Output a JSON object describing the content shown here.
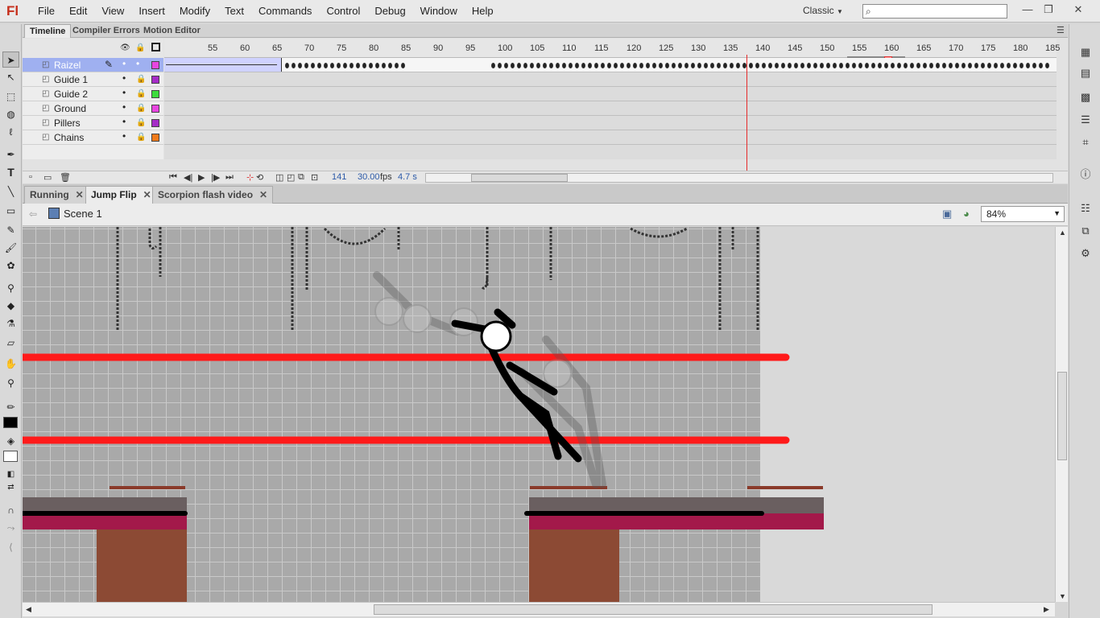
{
  "app": {
    "logo": "Fl"
  },
  "menu": [
    "File",
    "Edit",
    "View",
    "Insert",
    "Modify",
    "Text",
    "Commands",
    "Control",
    "Debug",
    "Window",
    "Help"
  ],
  "workspace": {
    "label": "Classic"
  },
  "search": {
    "placeholder": ""
  },
  "window_controls": {
    "minimize": "—",
    "restore": "❐",
    "close": "✕"
  },
  "timeline": {
    "tabs": [
      "Timeline",
      "Compiler Errors",
      "Motion Editor"
    ],
    "layers": [
      {
        "name": "Raizel",
        "color": "#e845e0",
        "selected": true
      },
      {
        "name": "Guide 1",
        "color": "#a52cc7",
        "selected": false
      },
      {
        "name": "Guide 2",
        "color": "#3cdc3c",
        "selected": false
      },
      {
        "name": "Ground",
        "color": "#e845e0",
        "selected": false
      },
      {
        "name": "Pillers",
        "color": "#a52cc7",
        "selected": false
      },
      {
        "name": "Chains",
        "color": "#f07a1a",
        "selected": false
      }
    ],
    "ruler_labels": [
      "55",
      "60",
      "65",
      "70",
      "75",
      "80",
      "85",
      "90",
      "95",
      "100",
      "105",
      "110",
      "115",
      "120",
      "125",
      "130",
      "135",
      "140",
      "145",
      "150",
      "155",
      "160",
      "165",
      "170",
      "175",
      "180",
      "185"
    ],
    "current_frame": "141",
    "fps": "30.00",
    "fps_unit": "fps",
    "elapsed": "4.7 s"
  },
  "doc_tabs": [
    {
      "label": "Running",
      "active": false
    },
    {
      "label": "Jump Flip",
      "active": true
    },
    {
      "label": "Scorpion flash video",
      "active": false
    }
  ],
  "editbar": {
    "scene": "Scene 1",
    "zoom": "84%"
  },
  "icons": {
    "tools": [
      "selection-icon",
      "subselection-icon",
      "free-transform-icon",
      "3d-rotation-icon",
      "lasso-icon",
      "pen-icon",
      "text-icon",
      "line-icon",
      "rectangle-icon",
      "pencil-icon",
      "brush-icon",
      "deco-icon",
      "bone-icon",
      "paint-bucket-icon",
      "eyedropper-icon",
      "eraser-icon",
      "hand-icon",
      "zoom-icon"
    ],
    "dock": [
      "properties-icon",
      "library-icon",
      "color-icon",
      "align-icon",
      "transform-icon",
      "info-icon",
      "components-icon",
      "motion-presets-icon",
      "code-snippets-icon"
    ]
  },
  "colors": {
    "stroke": "#000000",
    "fill": "#ffffff",
    "guide_line": "#ff0000",
    "playhead": "#e62b2b"
  }
}
